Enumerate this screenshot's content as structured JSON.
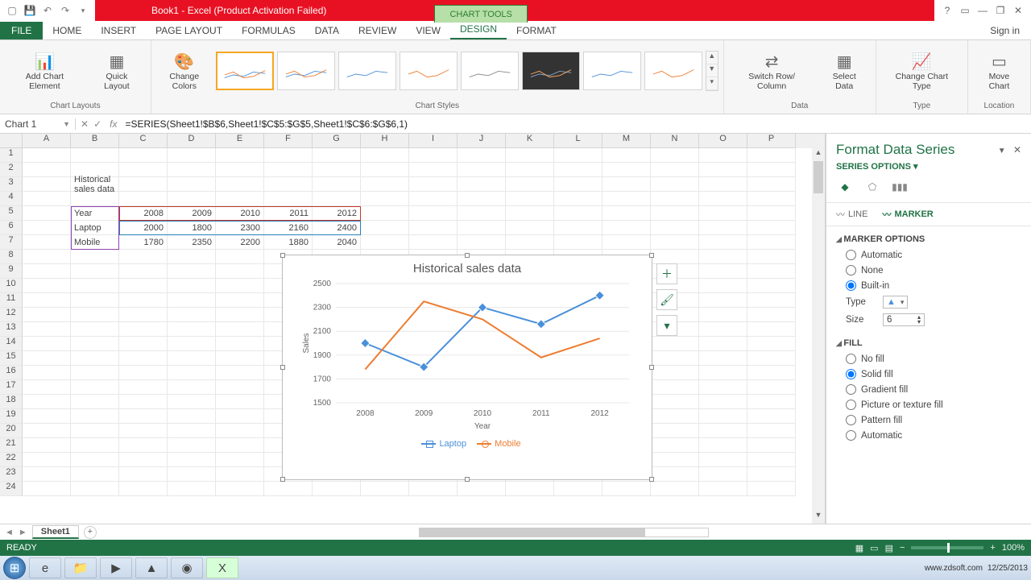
{
  "window": {
    "title": "Book1 - Excel (Product Activation Failed)",
    "chart_tools": "CHART TOOLS",
    "signin": "Sign in"
  },
  "ribbon": {
    "file": "FILE",
    "tabs": [
      "HOME",
      "INSERT",
      "PAGE LAYOUT",
      "FORMULAS",
      "DATA",
      "REVIEW",
      "VIEW",
      "DESIGN",
      "FORMAT"
    ],
    "groups": {
      "layouts": "Chart Layouts",
      "styles": "Chart Styles",
      "data": "Data",
      "type": "Type",
      "location": "Location"
    },
    "buttons": {
      "add_element": "Add Chart Element",
      "quick_layout": "Quick Layout",
      "change_colors": "Change Colors",
      "switch_rc": "Switch Row/ Column",
      "select_data": "Select Data",
      "change_type": "Change Chart Type",
      "move_chart": "Move Chart"
    }
  },
  "namebox": "Chart 1",
  "formula": "=SERIES(Sheet1!$B$6,Sheet1!$C$5:$G$5,Sheet1!$C$6:$G$6,1)",
  "columns": [
    "A",
    "B",
    "C",
    "D",
    "E",
    "F",
    "G",
    "H",
    "I",
    "J",
    "K",
    "L",
    "M",
    "N",
    "O",
    "P"
  ],
  "sheet": {
    "b3": "Historical sales data",
    "b5": "Year",
    "b6": "Laptop",
    "b7": "Mobile"
  },
  "chart_data": {
    "type": "line",
    "title": "Historical sales data",
    "xlabel": "Year",
    "ylabel": "Sales",
    "categories": [
      "2008",
      "2009",
      "2010",
      "2011",
      "2012"
    ],
    "series": [
      {
        "name": "Laptop",
        "values": [
          2000,
          1800,
          2300,
          2160,
          2400
        ],
        "color": "#4a90d9"
      },
      {
        "name": "Mobile",
        "values": [
          1780,
          2350,
          2200,
          1880,
          2040
        ],
        "color": "#ed7d31"
      }
    ],
    "ylim": [
      1500,
      2500
    ],
    "yticks": [
      1500,
      1700,
      1900,
      2100,
      2300,
      2500
    ]
  },
  "format_pane": {
    "title": "Format Data Series",
    "series_options": "SERIES OPTIONS",
    "line_tab": "LINE",
    "marker_tab": "MARKER",
    "marker_options": "MARKER OPTIONS",
    "m_auto": "Automatic",
    "m_none": "None",
    "m_builtin": "Built-in",
    "type_label": "Type",
    "size_label": "Size",
    "size_value": "6",
    "fill": "FILL",
    "f_no": "No fill",
    "f_solid": "Solid fill",
    "f_grad": "Gradient fill",
    "f_pic": "Picture or texture fill",
    "f_pat": "Pattern fill",
    "f_auto": "Automatic"
  },
  "sheet_tab": "Sheet1",
  "status": {
    "ready": "READY",
    "zoom": "100%"
  },
  "taskbar": {
    "watermark": "www.zdsoft.com",
    "date": "12/25/2013"
  }
}
